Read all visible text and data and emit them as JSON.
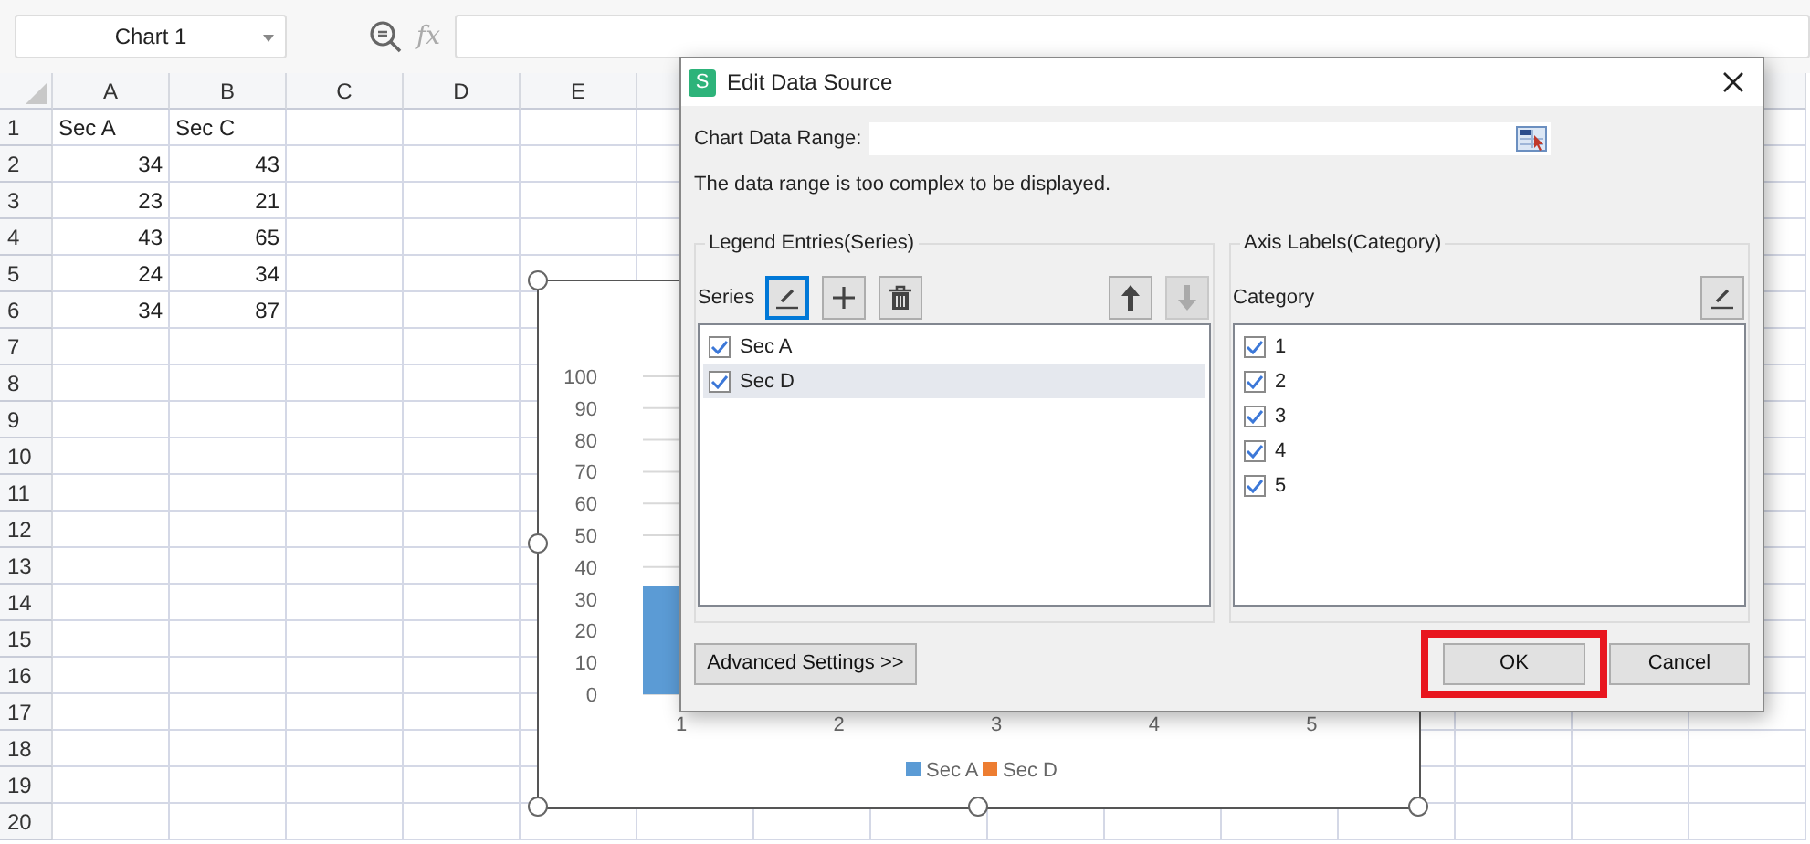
{
  "toolbar": {
    "name_box": "Chart 1",
    "formula_label": "fx"
  },
  "sheet": {
    "columns": [
      "A",
      "B",
      "C",
      "D",
      "E"
    ],
    "rows": [
      {
        "number": "1",
        "cells": [
          {
            "text": "Sec A",
            "kind": "text"
          },
          {
            "text": "Sec C",
            "kind": "text"
          }
        ]
      },
      {
        "number": "2",
        "cells": [
          {
            "text": "34",
            "kind": "number"
          },
          {
            "text": "43",
            "kind": "number"
          }
        ]
      },
      {
        "number": "3",
        "cells": [
          {
            "text": "23",
            "kind": "number"
          },
          {
            "text": "21",
            "kind": "number"
          }
        ]
      },
      {
        "number": "4",
        "cells": [
          {
            "text": "43",
            "kind": "number"
          },
          {
            "text": "65",
            "kind": "number"
          }
        ]
      },
      {
        "number": "5",
        "cells": [
          {
            "text": "24",
            "kind": "number"
          },
          {
            "text": "34",
            "kind": "number"
          }
        ]
      },
      {
        "number": "6",
        "cells": [
          {
            "text": "34",
            "kind": "number"
          },
          {
            "text": "87",
            "kind": "number"
          }
        ]
      },
      {
        "number": "7",
        "cells": []
      },
      {
        "number": "8",
        "cells": []
      },
      {
        "number": "9",
        "cells": []
      },
      {
        "number": "10",
        "cells": []
      },
      {
        "number": "11",
        "cells": []
      },
      {
        "number": "12",
        "cells": []
      },
      {
        "number": "13",
        "cells": []
      },
      {
        "number": "14",
        "cells": []
      },
      {
        "number": "15",
        "cells": []
      },
      {
        "number": "16",
        "cells": []
      },
      {
        "number": "17",
        "cells": []
      },
      {
        "number": "18",
        "cells": []
      },
      {
        "number": "19",
        "cells": []
      },
      {
        "number": "20",
        "cells": []
      }
    ]
  },
  "chart": {
    "chart_data": {
      "type": "bar",
      "categories": [
        "1",
        "2",
        "3",
        "4",
        "5"
      ],
      "series": [
        {
          "name": "Sec A",
          "color": "#5b9bd5",
          "values": [
            34,
            null,
            null,
            null,
            null
          ]
        },
        {
          "name": "Sec D",
          "color": "#ed7d31",
          "values": [
            null,
            null,
            null,
            null,
            null
          ]
        }
      ],
      "grid": true,
      "ylim": [
        0,
        100
      ],
      "yticks": [
        0,
        10,
        20,
        30,
        40,
        50,
        60,
        70,
        80,
        90,
        100
      ]
    }
  },
  "dialog": {
    "app_icon_letter": "S",
    "title": "Edit Data Source",
    "range_label": "Chart Data Range:",
    "message": "The data range is too complex to be displayed.",
    "legend_group": {
      "title": "Legend Entries(Series)",
      "label": "Series",
      "buttons": [
        {
          "kind": "edit",
          "focused": true,
          "disabled": false
        },
        {
          "kind": "add",
          "focused": false,
          "disabled": false
        },
        {
          "kind": "delete",
          "focused": false,
          "disabled": false
        },
        {
          "kind": "up",
          "focused": false,
          "disabled": false
        },
        {
          "kind": "down",
          "focused": false,
          "disabled": true
        }
      ],
      "items": [
        {
          "label": "Sec A",
          "checked": true,
          "selected": false
        },
        {
          "label": "Sec D",
          "checked": true,
          "selected": true
        }
      ]
    },
    "category_group": {
      "title": "Axis Labels(Category)",
      "label": "Category",
      "items": [
        {
          "label": "1",
          "checked": true,
          "selected": false
        },
        {
          "label": "2",
          "checked": true,
          "selected": false
        },
        {
          "label": "3",
          "checked": true,
          "selected": false
        },
        {
          "label": "4",
          "checked": true,
          "selected": false
        },
        {
          "label": "5",
          "checked": true,
          "selected": false
        }
      ]
    },
    "advanced_button": "Advanced Settings >>",
    "ok_button": {
      "label": "OK",
      "highlighted": true
    },
    "cancel_button": "Cancel"
  }
}
